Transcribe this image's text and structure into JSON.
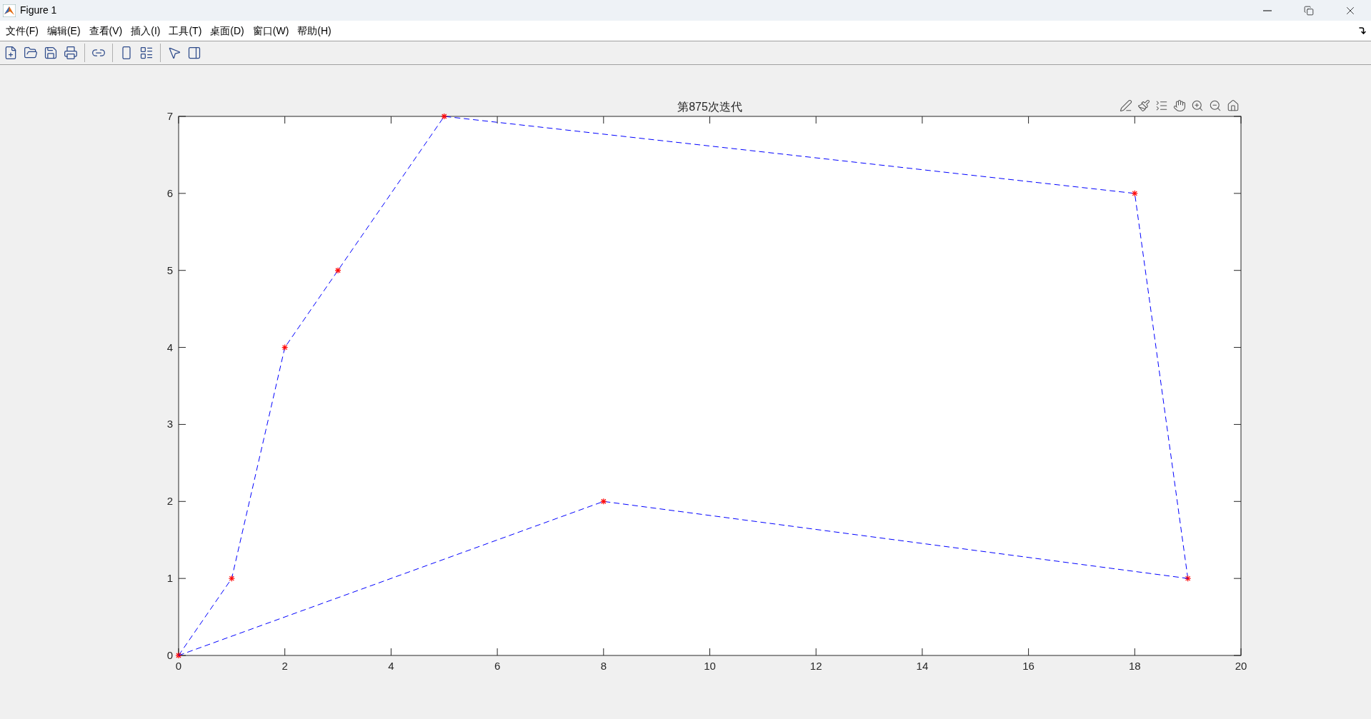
{
  "window": {
    "title": "Figure 1"
  },
  "menu": [
    "文件(F)",
    "编辑(E)",
    "查看(V)",
    "插入(I)",
    "工具(T)",
    "桌面(D)",
    "窗口(W)",
    "帮助(H)"
  ],
  "plot": {
    "chart_data": {
      "type": "line",
      "title": "第875次迭代",
      "series": [
        {
          "color": "#0000ff",
          "line_style": "dashed",
          "marker": "cross",
          "x": [
            0,
            1,
            2,
            3,
            5,
            18,
            19
          ],
          "values": [
            0,
            1,
            4,
            5,
            7,
            6,
            1
          ]
        },
        {
          "color": "#0000ff",
          "line_style": "dashed",
          "marker": "cross",
          "x": [
            0,
            8,
            19
          ],
          "values": [
            0,
            2,
            1
          ]
        }
      ],
      "xlim": [
        0,
        20
      ],
      "ylim": [
        0,
        7
      ],
      "xticks": [
        0,
        2,
        4,
        6,
        8,
        10,
        12,
        14,
        16,
        18,
        20
      ],
      "yticks": [
        0,
        1,
        2,
        3,
        4,
        5,
        6,
        7
      ]
    }
  }
}
